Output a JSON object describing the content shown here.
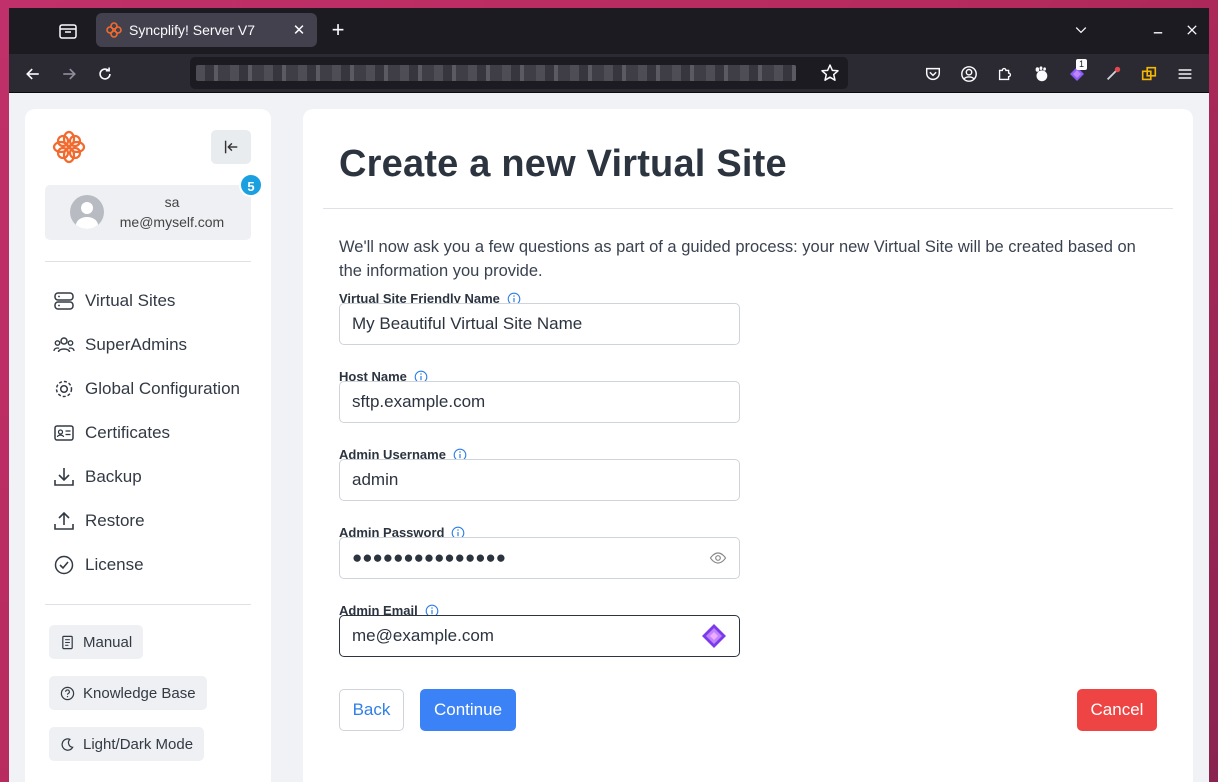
{
  "browser": {
    "tab_title": "Syncplify! Server V7",
    "new_tab_label": "+",
    "ext_badge": "1"
  },
  "sidebar": {
    "user": {
      "name": "sa",
      "email": "me@myself.com"
    },
    "badge_count": "5",
    "nav": [
      {
        "label": "Virtual Sites",
        "icon": "server-icon"
      },
      {
        "label": "SuperAdmins",
        "icon": "users-icon"
      },
      {
        "label": "Global Configuration",
        "icon": "gear-icon"
      },
      {
        "label": "Certificates",
        "icon": "id-card-icon"
      },
      {
        "label": "Backup",
        "icon": "download-icon"
      },
      {
        "label": "Restore",
        "icon": "upload-icon"
      },
      {
        "label": "License",
        "icon": "check-circle-icon"
      }
    ],
    "links": [
      {
        "label": "Manual",
        "icon": "book-icon"
      },
      {
        "label": "Knowledge Base",
        "icon": "question-icon"
      },
      {
        "label": "Light/Dark Mode",
        "icon": "moon-icon"
      }
    ]
  },
  "main": {
    "title": "Create a new Virtual Site",
    "intro": "We'll now ask you a few questions as part of a guided process: your new Virtual Site will be created based on the information you provide.",
    "fields": [
      {
        "label": "Virtual Site Friendly Name",
        "value": "My Beautiful Virtual Site Name"
      },
      {
        "label": "Host Name",
        "value": "sftp.example.com"
      },
      {
        "label": "Admin Username",
        "value": "admin"
      },
      {
        "label": "Admin Password",
        "value": "●●●●●●●●●●●●●●●"
      },
      {
        "label": "Admin Email",
        "value": "me@example.com"
      }
    ],
    "buttons": {
      "back": "Back",
      "continue": "Continue",
      "cancel": "Cancel"
    }
  },
  "colors": {
    "accent": "#3b82f6",
    "danger": "#ef4444",
    "brand": "#f26a2e",
    "badge": "#1a9fe0"
  }
}
